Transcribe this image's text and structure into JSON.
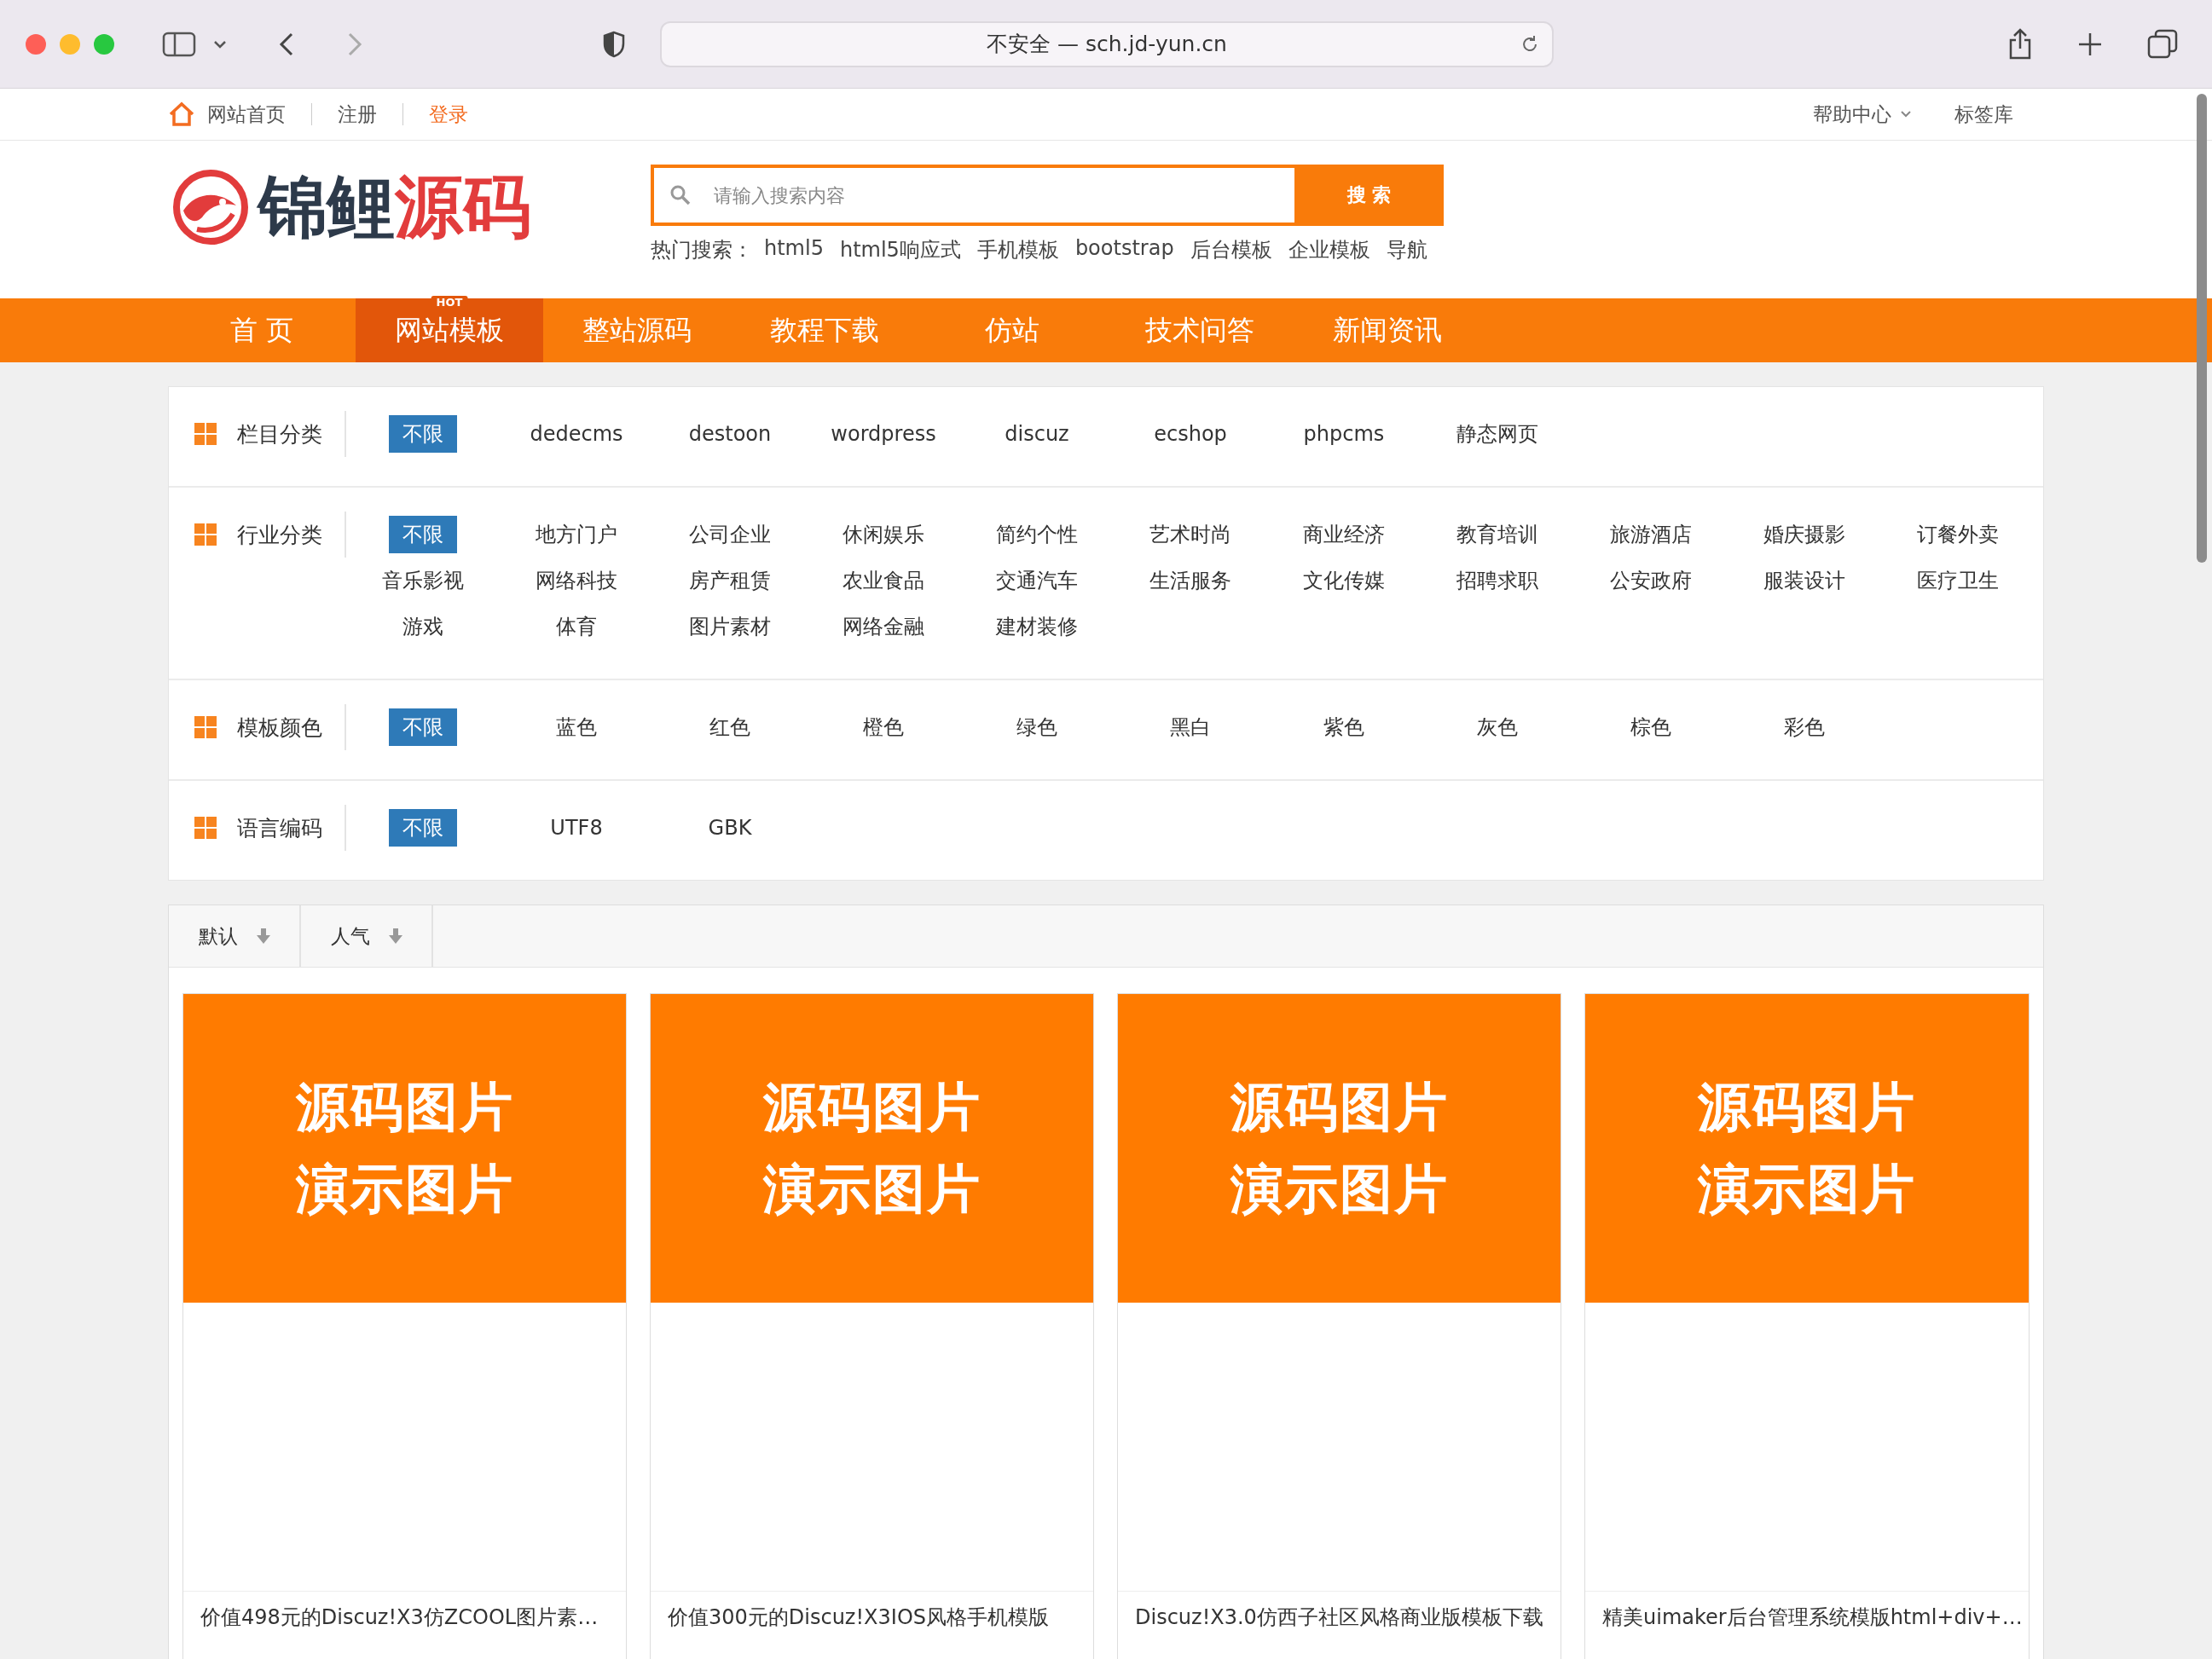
{
  "browser": {
    "address": "不安全 — sch.jd-yun.cn"
  },
  "topbar": {
    "left": [
      {
        "label": "网站首页",
        "kind": "home"
      },
      {
        "label": "注册",
        "kind": "link"
      },
      {
        "label": "登录",
        "kind": "accent"
      }
    ],
    "right": [
      {
        "label": "帮助中心",
        "kind": "dropdown"
      },
      {
        "label": "标签库",
        "kind": "link"
      }
    ]
  },
  "logo": {
    "dark": "锦鲤",
    "red": "源码"
  },
  "search": {
    "placeholder": "请输入搜索内容",
    "button": "搜 索"
  },
  "hot_search": {
    "label": "热门搜索：",
    "terms": [
      "html5",
      "html5响应式",
      "手机模板",
      "bootstrap",
      "后台模板",
      "企业模板",
      "导航"
    ]
  },
  "nav": [
    {
      "label": "首 页",
      "selected": false
    },
    {
      "label": "网站模板",
      "selected": true,
      "badge": "HOT"
    },
    {
      "label": "整站源码",
      "selected": false
    },
    {
      "label": "教程下载",
      "selected": false
    },
    {
      "label": "仿站",
      "selected": false
    },
    {
      "label": "技术问答",
      "selected": false
    },
    {
      "label": "新闻资讯",
      "selected": false
    }
  ],
  "filters": [
    {
      "label": "栏目分类",
      "options": [
        {
          "label": "不限",
          "selected": true
        },
        {
          "label": "dedecms",
          "selected": false
        },
        {
          "label": "destoon",
          "selected": false
        },
        {
          "label": "wordpress",
          "selected": false
        },
        {
          "label": "discuz",
          "selected": false
        },
        {
          "label": "ecshop",
          "selected": false
        },
        {
          "label": "phpcms",
          "selected": false
        },
        {
          "label": "静态网页",
          "selected": false
        }
      ]
    },
    {
      "label": "行业分类",
      "options": [
        {
          "label": "不限",
          "selected": true
        },
        {
          "label": "地方门户",
          "selected": false
        },
        {
          "label": "公司企业",
          "selected": false
        },
        {
          "label": "休闲娱乐",
          "selected": false
        },
        {
          "label": "简约个性",
          "selected": false
        },
        {
          "label": "艺术时尚",
          "selected": false
        },
        {
          "label": "商业经济",
          "selected": false
        },
        {
          "label": "教育培训",
          "selected": false
        },
        {
          "label": "旅游酒店",
          "selected": false
        },
        {
          "label": "婚庆摄影",
          "selected": false
        },
        {
          "label": "订餐外卖",
          "selected": false
        },
        {
          "label": "音乐影视",
          "selected": false
        },
        {
          "label": "网络科技",
          "selected": false
        },
        {
          "label": "房产租赁",
          "selected": false
        },
        {
          "label": "农业食品",
          "selected": false
        },
        {
          "label": "交通汽车",
          "selected": false
        },
        {
          "label": "生活服务",
          "selected": false
        },
        {
          "label": "文化传媒",
          "selected": false
        },
        {
          "label": "招聘求职",
          "selected": false
        },
        {
          "label": "公安政府",
          "selected": false
        },
        {
          "label": "服装设计",
          "selected": false
        },
        {
          "label": "医疗卫生",
          "selected": false
        },
        {
          "label": "游戏",
          "selected": false
        },
        {
          "label": "体育",
          "selected": false
        },
        {
          "label": "图片素材",
          "selected": false
        },
        {
          "label": "网络金融",
          "selected": false
        },
        {
          "label": "建材装修",
          "selected": false
        }
      ]
    },
    {
      "label": "模板颜色",
      "options": [
        {
          "label": "不限",
          "selected": true
        },
        {
          "label": "蓝色",
          "selected": false
        },
        {
          "label": "红色",
          "selected": false
        },
        {
          "label": "橙色",
          "selected": false
        },
        {
          "label": "绿色",
          "selected": false
        },
        {
          "label": "黑白",
          "selected": false
        },
        {
          "label": "紫色",
          "selected": false
        },
        {
          "label": "灰色",
          "selected": false
        },
        {
          "label": "棕色",
          "selected": false
        },
        {
          "label": "彩色",
          "selected": false
        }
      ]
    },
    {
      "label": "语言编码",
      "options": [
        {
          "label": "不限",
          "selected": true
        },
        {
          "label": "UTF8",
          "selected": false
        },
        {
          "label": "GBK",
          "selected": false
        }
      ]
    }
  ],
  "sort": [
    "默认",
    "人气"
  ],
  "cards": [
    {
      "image_text": [
        "源码图片",
        "演示图片"
      ],
      "title": "价值498元的Discuz!X3仿ZCOOL图片素…"
    },
    {
      "image_text": [
        "源码图片",
        "演示图片"
      ],
      "title": "价值300元的Discuz!X3IOS风格手机模版"
    },
    {
      "image_text": [
        "源码图片",
        "演示图片"
      ],
      "title": "Discuz!X3.0仿西子社区风格商业版模板下载"
    },
    {
      "image_text": [
        "源码图片",
        "演示图片"
      ],
      "title": "精美uimaker后台管理系统模版html+div+…"
    }
  ]
}
